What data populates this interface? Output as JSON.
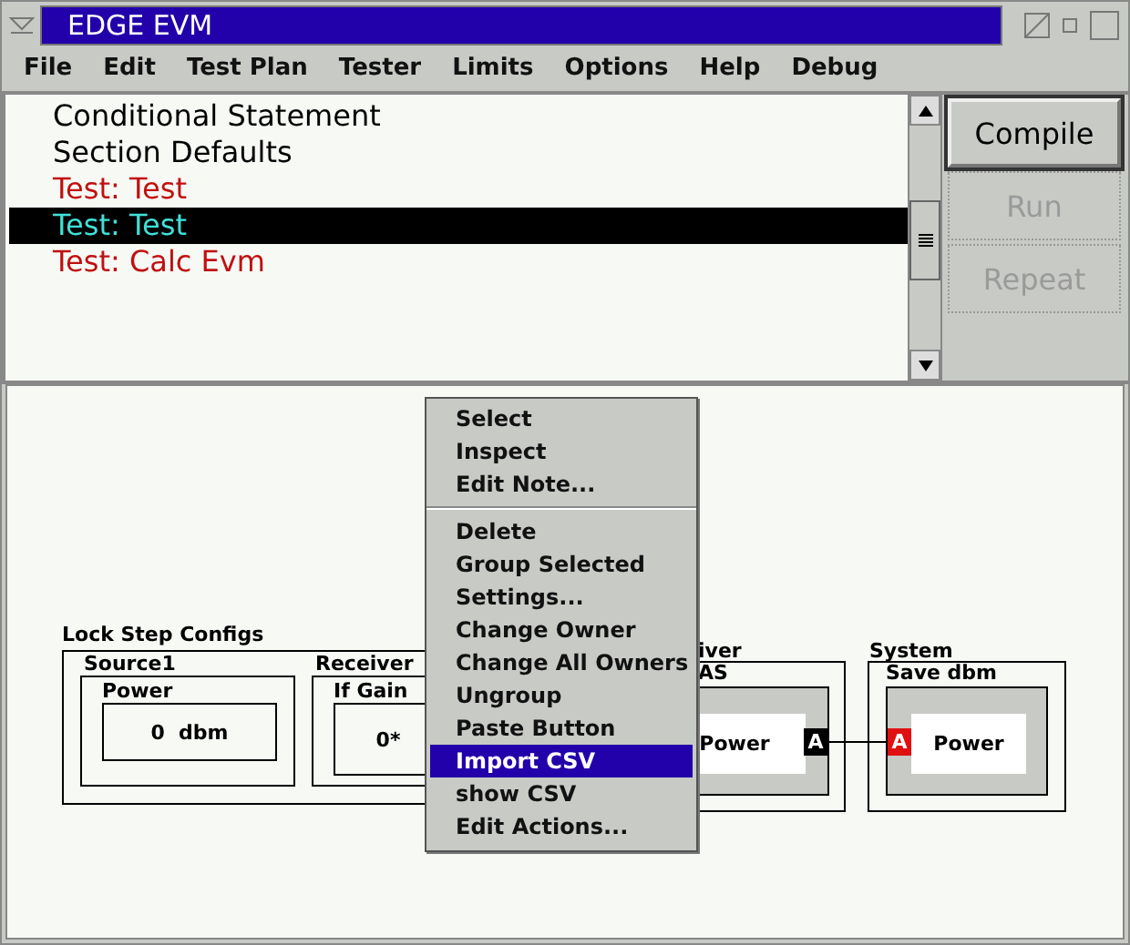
{
  "window": {
    "title": "EDGE EVM"
  },
  "menu_bar": [
    "File",
    "Edit",
    "Test Plan",
    "Tester",
    "Limits",
    "Options",
    "Help",
    "Debug"
  ],
  "test_list": [
    {
      "label": "Conditional Statement",
      "kind": "statement",
      "selected": false
    },
    {
      "label": "Section Defaults",
      "kind": "statement",
      "selected": false
    },
    {
      "label": "Test: Test",
      "kind": "test",
      "selected": false
    },
    {
      "label": "Test: Test",
      "kind": "test",
      "selected": true
    },
    {
      "label": "Test: Calc Evm",
      "kind": "test",
      "selected": false
    }
  ],
  "buttons": [
    {
      "label": "Compile",
      "disabled": false
    },
    {
      "label": "Run",
      "disabled": true
    },
    {
      "label": "Repeat",
      "disabled": true
    }
  ],
  "canvas": {
    "group_title": "Lock Step Configs",
    "blocks": [
      {
        "title": "Source1",
        "param": "Power",
        "value": "0  dbm"
      },
      {
        "title": "Receiver",
        "param": "If Gain",
        "value": "0*"
      }
    ],
    "partial_block": {
      "title": "iver",
      "subtitle": "AS",
      "param": "Power",
      "port": "A"
    },
    "system_block": {
      "title": "System",
      "subtitle": "Save dbm",
      "param": "Power",
      "port": "A"
    }
  },
  "context_menu": [
    {
      "label": "Select",
      "selected": false,
      "separator_before": false
    },
    {
      "label": "Inspect",
      "selected": false,
      "separator_before": false
    },
    {
      "label": "Edit Note...",
      "selected": false,
      "separator_before": false
    },
    {
      "label": "Delete",
      "selected": false,
      "separator_before": true
    },
    {
      "label": "Group Selected",
      "selected": false,
      "separator_before": false
    },
    {
      "label": "Settings...",
      "selected": false,
      "separator_before": false
    },
    {
      "label": "Change Owner",
      "selected": false,
      "separator_before": false
    },
    {
      "label": "Change All Owners",
      "selected": false,
      "separator_before": false
    },
    {
      "label": "Ungroup",
      "selected": false,
      "separator_before": false
    },
    {
      "label": "Paste Button",
      "selected": false,
      "separator_before": false
    },
    {
      "label": "Import CSV",
      "selected": true,
      "separator_before": false
    },
    {
      "label": "show CSV",
      "selected": false,
      "separator_before": false
    },
    {
      "label": "Edit Actions...",
      "selected": false,
      "separator_before": false
    }
  ]
}
